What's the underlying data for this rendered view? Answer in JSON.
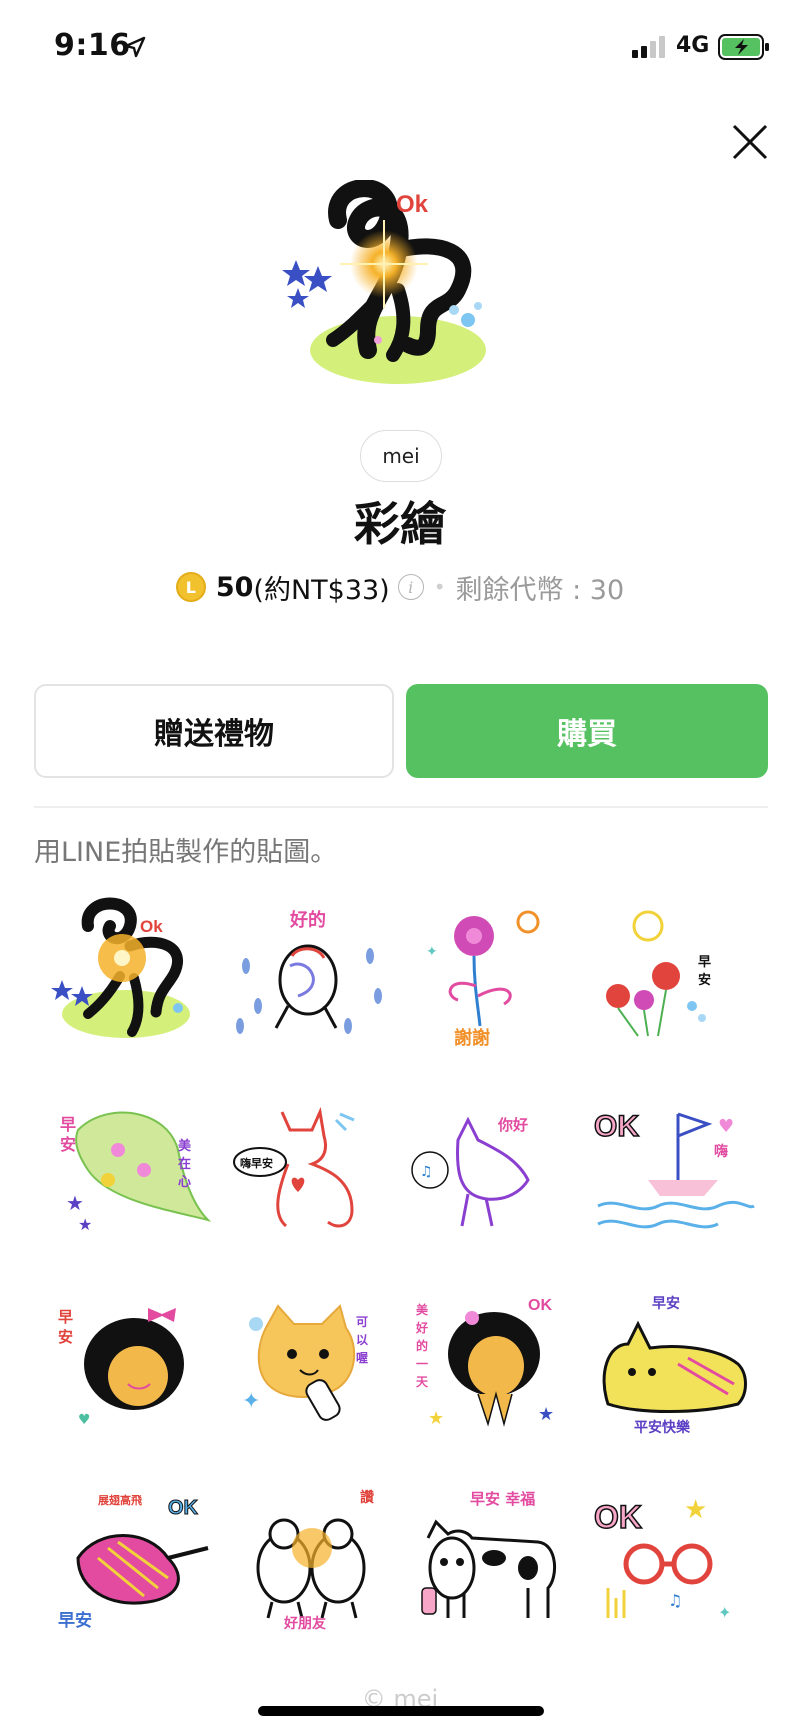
{
  "status_bar": {
    "time": "9:16",
    "location_icon": "location-arrow-icon",
    "network": "4G",
    "signal_icon": "cellular-signal-icon",
    "battery_icon": "battery-charging-icon",
    "battery_color": "#56c160"
  },
  "close_icon": "close-icon",
  "product": {
    "author": "mei",
    "title": "彩繪",
    "coin_symbol": "L",
    "price": "50",
    "price_approx": "(約NT$33)",
    "info_icon_label": "i",
    "remaining": "剩餘代幣 : 30"
  },
  "actions": {
    "gift_label": "贈送禮物",
    "buy_label": "購買",
    "buy_color": "#56c160"
  },
  "description": "用LINE拍貼製作的貼圖。",
  "stickers": {
    "s1": {
      "text": "Ok"
    },
    "s2": {
      "text": "好的"
    },
    "s3": {
      "text": "謝謝"
    },
    "s4": {
      "text1": "早",
      "text2": "安"
    },
    "s5": {
      "t1": "早",
      "t2": "安",
      "t3": "美",
      "t4": "在",
      "t5": "心"
    },
    "s6": {
      "text": "嗨早安"
    },
    "s7": {
      "text": "你好"
    },
    "s8": {
      "text1": "OK",
      "text2": "嗨"
    },
    "s9": {
      "t1": "早",
      "t2": "安"
    },
    "s10": {
      "t1": "可",
      "t2": "以",
      "t3": "喔"
    },
    "s11": {
      "t1": "美",
      "t2": "好",
      "t3": "的",
      "t4": "一",
      "t5": "天",
      "t6": "OK"
    },
    "s12": {
      "t1": "早安",
      "t2": "平安快樂"
    },
    "s13": {
      "t1": "展翅高飛",
      "t2": "OK",
      "t3": "早安"
    },
    "s14": {
      "t1": "讚",
      "t2": "好朋友"
    },
    "s15": {
      "text": "早安 幸福"
    },
    "s16": {
      "text": "OK"
    }
  },
  "copyright": "© mei"
}
